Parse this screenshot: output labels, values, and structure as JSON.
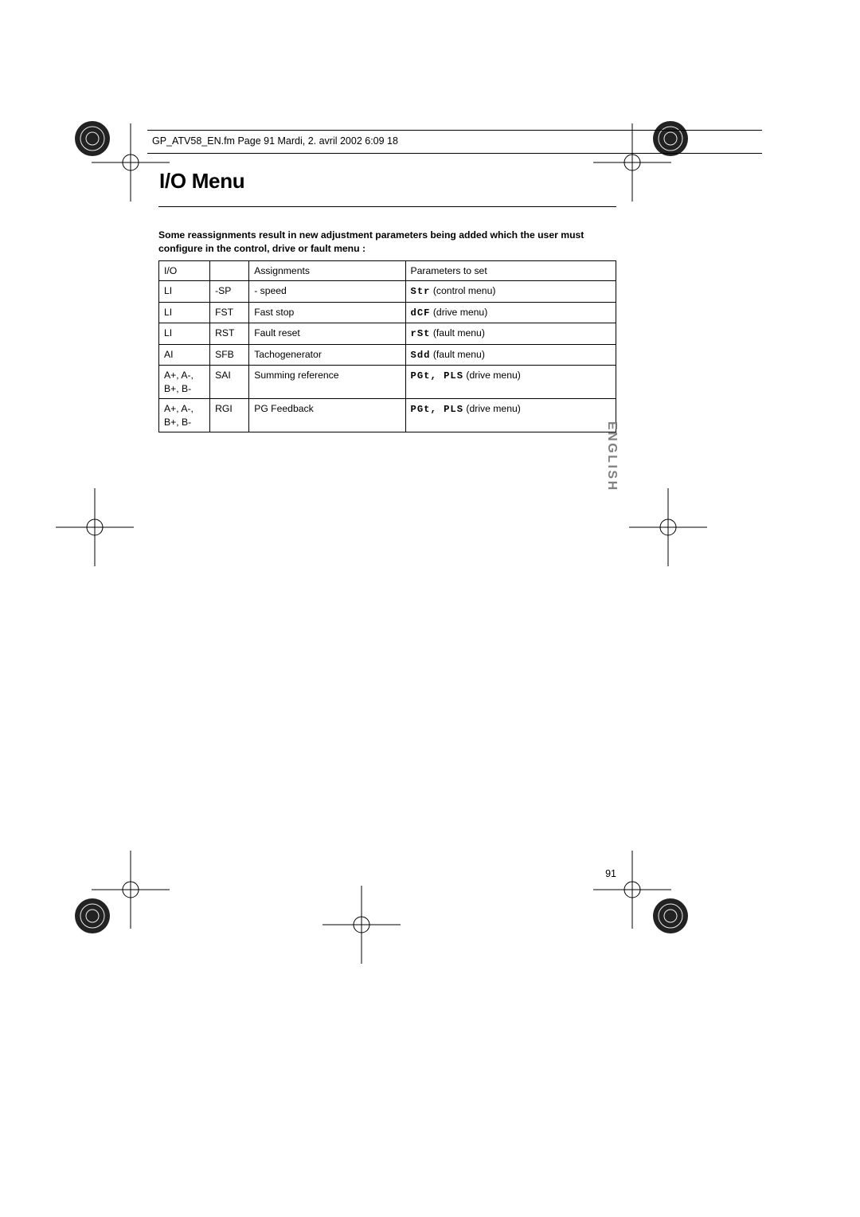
{
  "header": "GP_ATV58_EN.fm  Page 91  Mardi, 2. avril 2002  6:09 18",
  "title": "I/O Menu",
  "intro": "Some reassignments result in new adjustment parameters being added which the user must configure in the control, drive or fault menu :",
  "table": {
    "head": {
      "c0": "I/O",
      "c1": "",
      "c2": "Assignments",
      "c3": "Parameters to set"
    },
    "rows": [
      {
        "c0": "LI",
        "c1": "-SP",
        "c2": "- speed",
        "seg": "Str",
        "tail": " (control menu)"
      },
      {
        "c0": "LI",
        "c1": "FST",
        "c2": "Fast stop",
        "seg": "dCF",
        "tail": " (drive menu)"
      },
      {
        "c0": "LI",
        "c1": "RST",
        "c2": "Fault reset",
        "seg": "rSt",
        "tail": " (fault menu)"
      },
      {
        "c0": "AI",
        "c1": "SFB",
        "c2": "Tachogenerator",
        "seg": "Sdd",
        "tail": " (fault menu)"
      },
      {
        "c0": "A+, A-, B+, B-",
        "c1": "SAI",
        "c2": "Summing reference",
        "seg": "PGt, PLS",
        "tail": " (drive menu)"
      },
      {
        "c0": "A+, A-, B+, B-",
        "c1": "RGI",
        "c2": "PG Feedback",
        "seg": "PGt, PLS",
        "tail": " (drive menu)"
      }
    ]
  },
  "lang": "ENGLISH",
  "page_no": "91"
}
